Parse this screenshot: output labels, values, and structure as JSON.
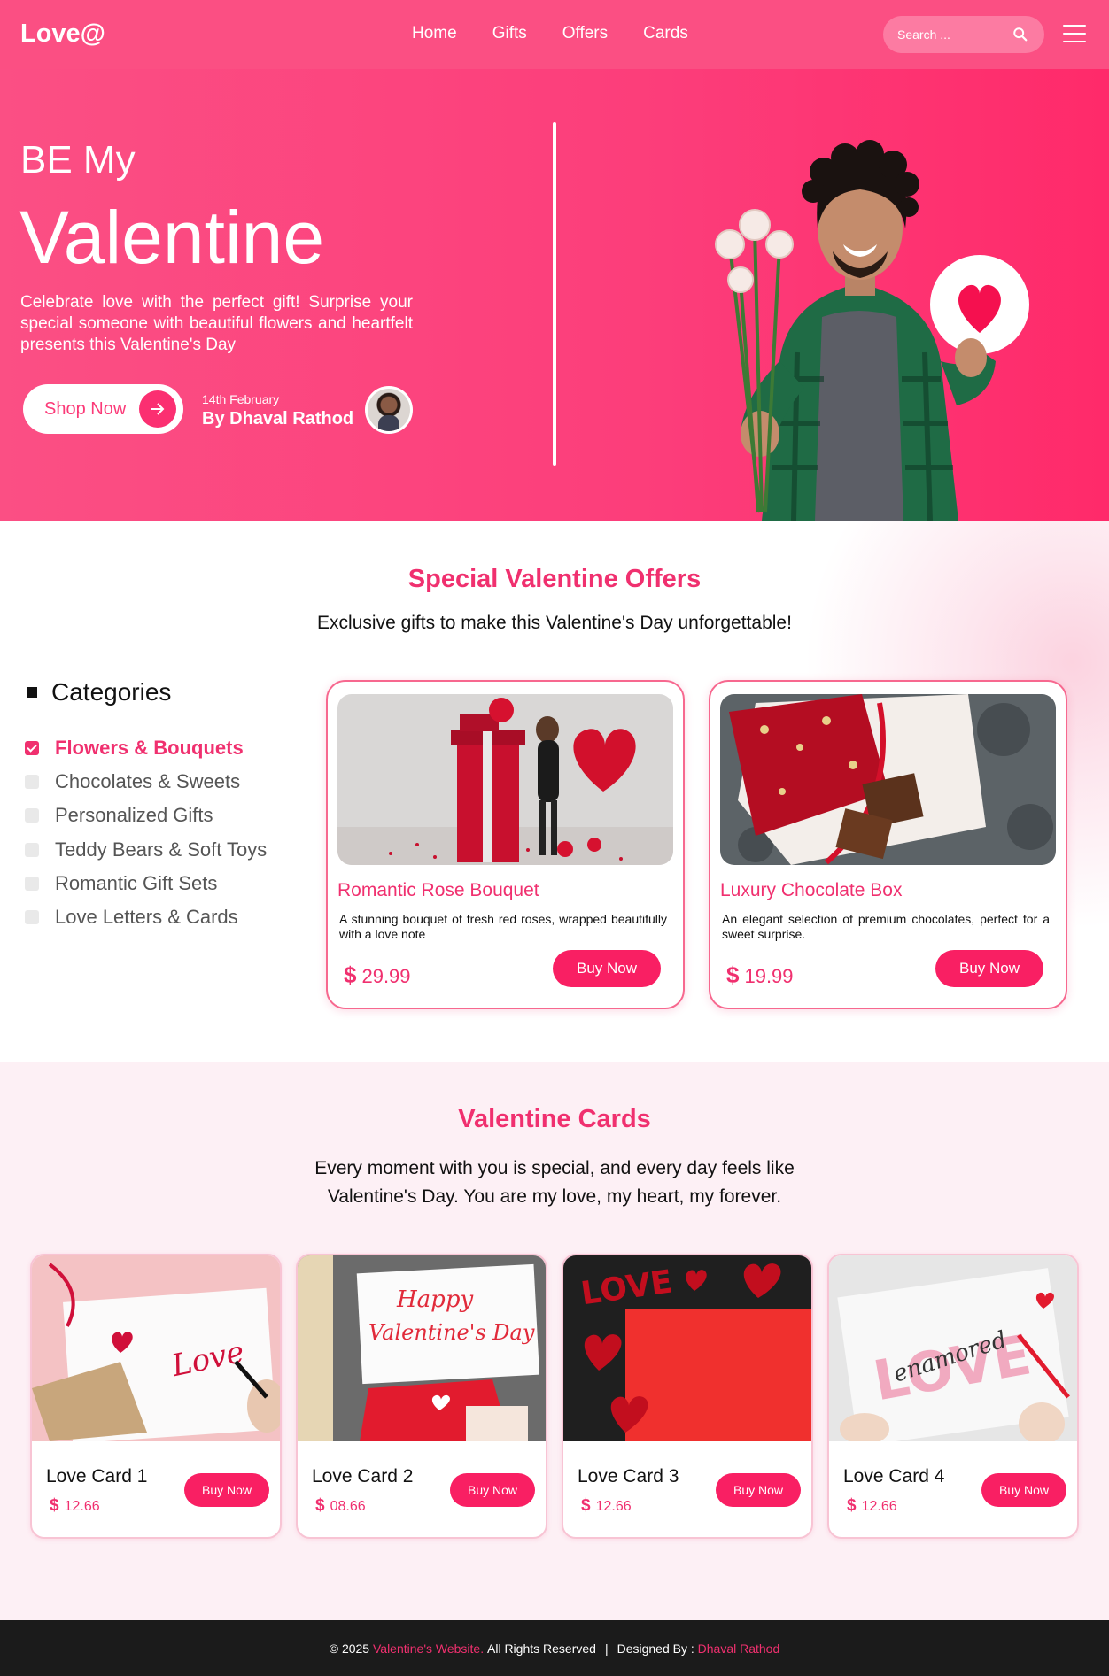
{
  "nav": {
    "logo": "Love@",
    "links": [
      "Home",
      "Gifts",
      "Offers",
      "Cards"
    ],
    "search_placeholder": "Search ..."
  },
  "hero": {
    "small_title": "BE My",
    "big_title": "Valentine",
    "description": "Celebrate love with the perfect gift! Surprise your special someone with beautiful flowers and heartfelt presents this Valentine's Day",
    "shop_button": "Shop Now",
    "date": "14th February",
    "author": "By Dhaval Rathod"
  },
  "offers": {
    "title": "Special Valentine Offers",
    "subtitle": "Exclusive gifts to make this Valentine's Day unforgettable!",
    "categories_heading": "Categories",
    "categories": [
      {
        "label": "Flowers & Bouquets",
        "checked": true
      },
      {
        "label": "Chocolates & Sweets",
        "checked": false
      },
      {
        "label": "Personalized Gifts",
        "checked": false
      },
      {
        "label": "Teddy Bears & Soft Toys",
        "checked": false
      },
      {
        "label": "Romantic Gift Sets",
        "checked": false
      },
      {
        "label": "Love Letters & Cards",
        "checked": false
      }
    ],
    "products": [
      {
        "title": "Romantic Rose Bouquet",
        "description": "A stunning bouquet of fresh red roses, wrapped beautifully with a love note",
        "currency": "$",
        "price": "29.99",
        "button": "Buy Now"
      },
      {
        "title": "Luxury Chocolate Box",
        "description": "An elegant selection of premium chocolates, perfect for a sweet surprise.",
        "currency": "$",
        "price": "19.99",
        "button": "Buy Now"
      }
    ]
  },
  "cards": {
    "title": "Valentine Cards",
    "subtitle_line1": "Every moment with you is special, and every day feels like",
    "subtitle_line2": "Valentine's Day. You are my love, my heart, my forever.",
    "items": [
      {
        "name": "Love Card 1",
        "currency": "$",
        "price": "12.66",
        "button": "Buy Now",
        "art_text": "Love"
      },
      {
        "name": "Love Card 2",
        "currency": "$",
        "price": "08.66",
        "button": "Buy Now",
        "art_text": "Happy Valentine's Day"
      },
      {
        "name": "Love Card 3",
        "currency": "$",
        "price": "12.66",
        "button": "Buy Now",
        "art_text": "LOVE"
      },
      {
        "name": "Love Card 4",
        "currency": "$",
        "price": "12.66",
        "button": "Buy Now",
        "art_text": "LOVE enamored"
      }
    ]
  },
  "footer": {
    "copyright": "© 2025",
    "site": "Valentine's Website.",
    "rights": "All Rights Reserved",
    "separator": "|",
    "designed_label": "Designed By  :",
    "designer": "Dhaval Rathod"
  },
  "colors": {
    "accent": "#f0306f",
    "nav_bg": "#fb4f83",
    "button": "#f91f63",
    "footer_bg": "#1b1b1b"
  },
  "icons": [
    "search-icon",
    "menu-icon",
    "arrow-right-icon",
    "checkbox-icon",
    "dollar-icon"
  ]
}
